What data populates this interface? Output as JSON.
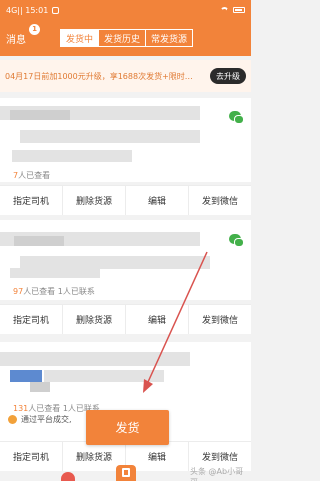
{
  "statusbar": {
    "left": "4G|| 15:01",
    "app_badge": "Q"
  },
  "navbar": {
    "messages_label": "消息",
    "messages_badge": "1",
    "tabs": [
      "发货中",
      "发货历史",
      "常发货源"
    ]
  },
  "promo": {
    "text": "04月17日前加1000元升级，享1688次发货+限时…",
    "button": "去升级"
  },
  "cards": [
    {
      "views": "7",
      "views_label": "人已查看"
    },
    {
      "views": "97",
      "views_label": "人已查看 1人已联系"
    },
    {
      "views": "131",
      "views_label": "人已查看 1人已联系"
    }
  ],
  "actions": [
    "指定司机",
    "删除货源",
    "编辑",
    "发到微信"
  ],
  "notice": "通过平台成交,",
  "fab": "发货",
  "watermark": "头条 @Ab小哥哥"
}
